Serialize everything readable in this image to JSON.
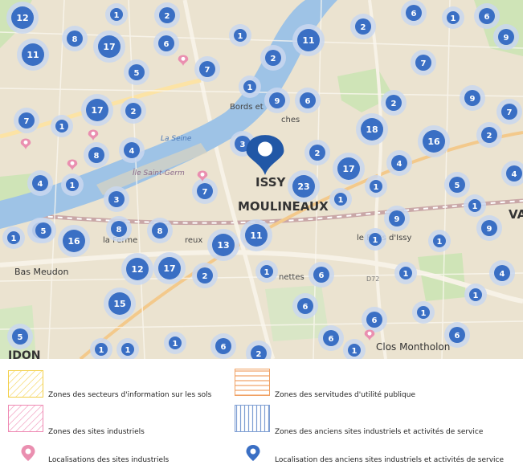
{
  "map": {
    "place_labels": [
      {
        "id": "issy",
        "text": "ISSY"
      },
      {
        "id": "moulineaux",
        "text": "MOULINEAUX"
      },
      {
        "id": "bords",
        "text": "Bords et"
      },
      {
        "id": "ruches",
        "text": "ches"
      },
      {
        "id": "ile",
        "text": "Île Saint-Germ"
      },
      {
        "id": "laseine",
        "text": "La Seine"
      },
      {
        "id": "ferme",
        "text": "la Ferme"
      },
      {
        "id": "creux",
        "text": "reux"
      },
      {
        "id": "basmeudon",
        "text": "Bas Meudon"
      },
      {
        "id": "lesforts",
        "text": "le    Forts d'Issy"
      },
      {
        "id": "nettes",
        "text": "nettes"
      },
      {
        "id": "closmontholon",
        "text": "Clos Montholon"
      },
      {
        "id": "va",
        "text": "VA"
      },
      {
        "id": "idon",
        "text": "IDON"
      },
      {
        "id": "d72",
        "text": "D72"
      }
    ],
    "clusters": [
      {
        "n": "12"
      },
      {
        "n": "1"
      },
      {
        "n": "2"
      },
      {
        "n": "6"
      },
      {
        "n": "1"
      },
      {
        "n": "6"
      },
      {
        "n": "11"
      },
      {
        "n": "8"
      },
      {
        "n": "17"
      },
      {
        "n": "6"
      },
      {
        "n": "1"
      },
      {
        "n": "11"
      },
      {
        "n": "9"
      },
      {
        "n": "2"
      },
      {
        "n": "7"
      },
      {
        "n": "5"
      },
      {
        "n": "7"
      },
      {
        "n": "2"
      },
      {
        "n": "7"
      },
      {
        "n": "1"
      },
      {
        "n": "17"
      },
      {
        "n": "2"
      },
      {
        "n": "9"
      },
      {
        "n": "6"
      },
      {
        "n": "2"
      },
      {
        "n": "9"
      },
      {
        "n": "7"
      },
      {
        "n": "1"
      },
      {
        "n": "18"
      },
      {
        "n": "16"
      },
      {
        "n": "2"
      },
      {
        "n": "8"
      },
      {
        "n": "4"
      },
      {
        "n": "3"
      },
      {
        "n": "2"
      },
      {
        "n": "17"
      },
      {
        "n": "4"
      },
      {
        "n": "4"
      },
      {
        "n": "1"
      },
      {
        "n": "7"
      },
      {
        "n": "23"
      },
      {
        "n": "1"
      },
      {
        "n": "1"
      },
      {
        "n": "5"
      },
      {
        "n": "4"
      },
      {
        "n": "3"
      },
      {
        "n": "8"
      },
      {
        "n": "1"
      },
      {
        "n": "9"
      },
      {
        "n": "1"
      },
      {
        "n": "2"
      },
      {
        "n": "5"
      },
      {
        "n": "16"
      },
      {
        "n": "8"
      },
      {
        "n": "13"
      },
      {
        "n": "11"
      },
      {
        "n": "1"
      },
      {
        "n": "1"
      },
      {
        "n": "9"
      },
      {
        "n": "12"
      },
      {
        "n": "17"
      },
      {
        "n": "2"
      },
      {
        "n": "1"
      },
      {
        "n": "6"
      },
      {
        "n": "1"
      },
      {
        "n": "4"
      },
      {
        "n": "15"
      },
      {
        "n": "6"
      },
      {
        "n": "1"
      },
      {
        "n": "1"
      },
      {
        "n": "6"
      },
      {
        "n": "6"
      },
      {
        "n": "5"
      },
      {
        "n": "1"
      },
      {
        "n": "6"
      },
      {
        "n": "2"
      },
      {
        "n": "1"
      },
      {
        "n": "1"
      },
      {
        "n": "6"
      },
      {
        "n": "1"
      }
    ]
  },
  "legend": {
    "items": [
      {
        "id": "sis",
        "label": "Zones des secteurs d'information sur les sols"
      },
      {
        "id": "sup",
        "label": "Zones des servitudes d'utilité publique"
      },
      {
        "id": "si",
        "label": "Zones des sites industriels"
      },
      {
        "id": "asi",
        "label": "Zones des anciens sites industriels et activités de service"
      },
      {
        "id": "loc_si",
        "label": "Localisations des sites industriels"
      },
      {
        "id": "loc_asi",
        "label": "Localisation des anciens sites industriels et activités de service"
      }
    ]
  },
  "colors": {
    "cluster_fill": "#3a6fc4",
    "cluster_ring": "#c9d7ef",
    "pin_blue": "#2157a6",
    "pin_pink": "#ea8fb0",
    "sis_yellow": "#f3d04a",
    "sup_orange": "#f0a062",
    "si_pink": "#ef89b3",
    "asi_blue": "#7f9fd3",
    "water": "#7aa7d6",
    "land": "#efe7d4"
  }
}
